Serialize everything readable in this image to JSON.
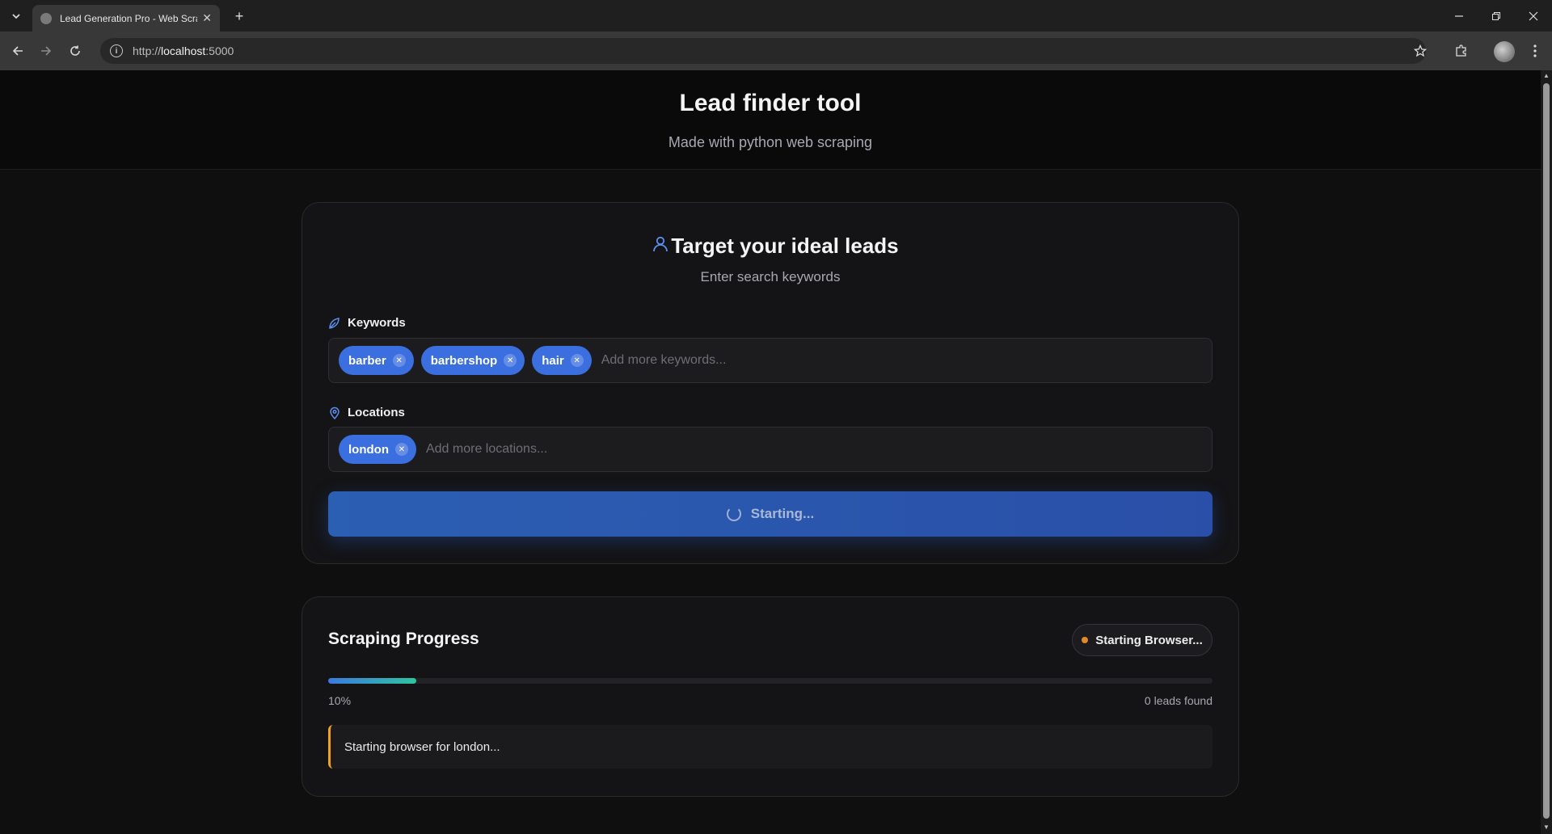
{
  "browser": {
    "tab_title": "Lead Generation Pro - Web Scraper",
    "url_scheme": "http://",
    "url_host": "localhost",
    "url_port": ":5000"
  },
  "header": {
    "title": "Lead finder tool",
    "subtitle": "Made with python web scraping"
  },
  "search": {
    "title": "Target your ideal leads",
    "subtitle": "Enter search keywords",
    "keywords_label": "Keywords",
    "keywords": [
      "barber",
      "barbershop",
      "hair"
    ],
    "keywords_placeholder": "Add more keywords...",
    "locations_label": "Locations",
    "locations": [
      "london"
    ],
    "locations_placeholder": "Add more locations...",
    "start_button_label": "Starting..."
  },
  "progress": {
    "title": "Scraping Progress",
    "status": "Starting Browser...",
    "status_color": "#e08a2a",
    "percent": 10,
    "percent_label": "10%",
    "leads_label": "0 leads found",
    "log_message": "Starting browser for london..."
  },
  "colors": {
    "accent": "#3b6fe0",
    "log_border": "#f0a020"
  }
}
